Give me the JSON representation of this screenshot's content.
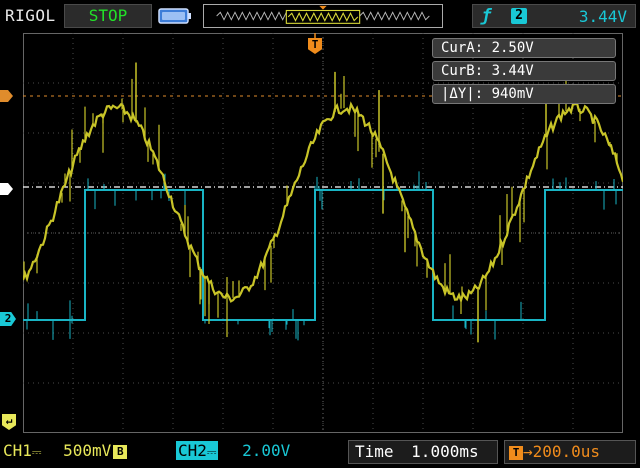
{
  "app": {
    "brand": "RIGOL"
  },
  "header": {
    "run_status": "STOP",
    "trigger": {
      "edge_icon": "rising-edge-icon",
      "source": "2",
      "level": "3.44V",
      "color": "#19c8d6"
    }
  },
  "cursors": {
    "cur_a": "CurA: 2.50V",
    "cur_b": "CurB: 3.44V",
    "delta": "|ΔY|: 940mV"
  },
  "markers": {
    "trigger": "T",
    "ch2": "2",
    "ch1": "↵"
  },
  "channels": {
    "ch1": {
      "label": "CH1",
      "coupling_icon": "dc-coupling-icon",
      "scale": "500mV",
      "bw": "B",
      "color": "#e8e85a"
    },
    "ch2": {
      "label": "CH2",
      "coupling_icon": "dc-coupling-icon",
      "scale": "2.00V",
      "color": "#19c8d6"
    }
  },
  "timebase": {
    "label": "Time",
    "value": "1.000ms"
  },
  "trigger_delay": {
    "icon": "T",
    "value": "→200.0us",
    "color": "#f08c1c"
  },
  "colors": {
    "grid": "#555555",
    "background": "#000000",
    "cursor_line": "#e08c2c"
  }
}
